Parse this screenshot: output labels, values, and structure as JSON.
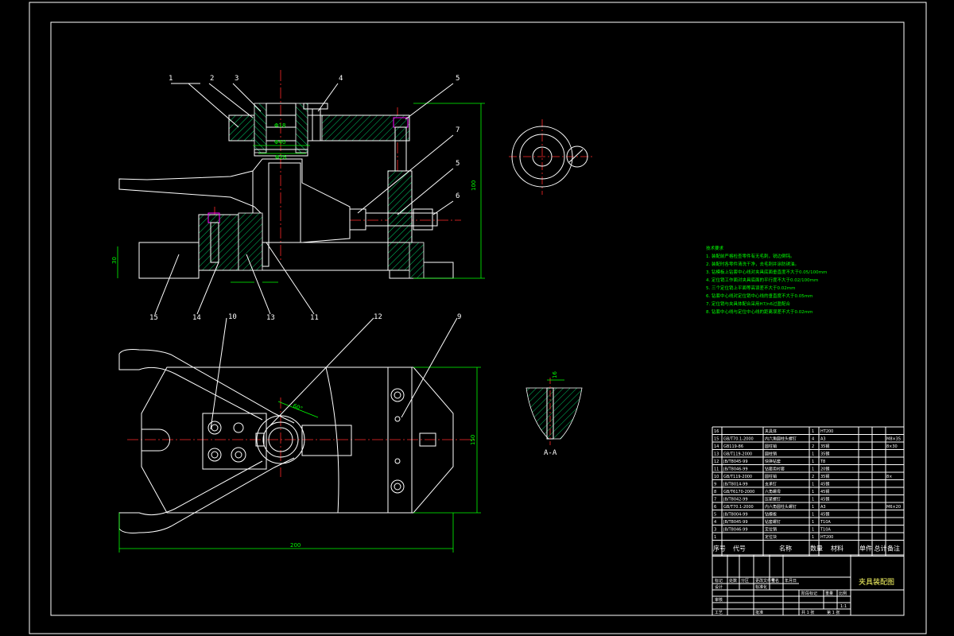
{
  "balloons_front": [
    "1",
    "2",
    "3",
    "4",
    "5",
    "7",
    "5",
    "6",
    "15",
    "14",
    "13",
    "11"
  ],
  "balloons_top": [
    "10",
    "12",
    "9"
  ],
  "section_label": "A-A",
  "tech_title": "技术要求",
  "tech_notes": [
    "1. 装配前严格检查零件有无毛刺，锐边倒钝。",
    "2. 装配时各零件清洗干净，去毛刺并涂防锈油。",
    "3. 钻模板上钻套中心线对夹具底面垂直度不大于0.05/100mm",
    "4. 定位销工作面对夹具底面的平行度不大于0.02/100mm",
    "5. 三个定位销上平面等高误差不大于0.02mm",
    "6. 钻套中心线对定位销中心线的垂直度不大于0.05mm",
    "7. 定位销与夹具体配合采用H7/n6过盈配合",
    "8. 钻套中心线与定位中心线的距离误差不大于0.02mm"
  ],
  "bom_rows": [
    {
      "no": "16",
      "code": "",
      "name": "夹具体",
      "qty": "1",
      "mat": "HT200",
      "note": ""
    },
    {
      "no": "15",
      "code": "GB/T70.1-2000",
      "name": "内六角圆柱头螺钉",
      "qty": "4",
      "mat": "A3",
      "note": "M8×35"
    },
    {
      "no": "14",
      "code": "GB119-86",
      "name": "圆柱销",
      "qty": "2",
      "mat": "35钢",
      "note": "8×30"
    },
    {
      "no": "13",
      "code": "GB/T119-2000",
      "name": "圆柱销",
      "qty": "1",
      "mat": "35钢",
      "note": ""
    },
    {
      "no": "12",
      "code": "JB/T8045-99",
      "name": "快换钻套",
      "qty": "1",
      "mat": "T8",
      "note": ""
    },
    {
      "no": "11",
      "code": "JB/T8046-99",
      "name": "钻套用衬套",
      "qty": "1",
      "mat": "20钢",
      "note": ""
    },
    {
      "no": "10",
      "code": "GB/T119-2000",
      "name": "圆柱销",
      "qty": "2",
      "mat": "35钢",
      "note": "8×"
    },
    {
      "no": "9",
      "code": "JB/T8014-99",
      "name": "支承钉",
      "qty": "1",
      "mat": "45钢",
      "note": ""
    },
    {
      "no": "8",
      "code": "GB/T6170-2000",
      "name": "六角螺母",
      "qty": "1",
      "mat": "45钢",
      "note": ""
    },
    {
      "no": "7",
      "code": "JB/T8042-99",
      "name": "压紧螺钉",
      "qty": "1",
      "mat": "45钢",
      "note": ""
    },
    {
      "no": "6",
      "code": "GB/T70.1-2000",
      "name": "内六角圆柱头螺钉",
      "qty": "1",
      "mat": "A3",
      "note": "M6×20"
    },
    {
      "no": "5",
      "code": "JB/T8004-99",
      "name": "钻模板",
      "qty": "1",
      "mat": "45钢",
      "note": ""
    },
    {
      "no": "4",
      "code": "JB/T8045-99",
      "name": "钻套螺钉",
      "qty": "1",
      "mat": "T10A",
      "note": ""
    },
    {
      "no": "3",
      "code": "JB/T8046-99",
      "name": "定位销",
      "qty": "1",
      "mat": "T10A",
      "note": ""
    },
    {
      "no": "1",
      "code": "",
      "name": "定位块",
      "qty": "1",
      "mat": "HT200",
      "note": ""
    }
  ],
  "bom_header": {
    "no": "序号",
    "code": "代号",
    "name": "名称",
    "qty": "数量",
    "mat": "材料",
    "unit": "单件 总计",
    "weight": "重量",
    "note": "备注"
  },
  "title_block": {
    "drawing_title": "夹具装配图",
    "labels": [
      "标记",
      "处数",
      "分区",
      "更改文件号",
      "签名",
      "年月日",
      "设计",
      "标准化",
      "审核",
      "工艺",
      "批准",
      "阶段标记",
      "重量",
      "比例",
      "共 1 张",
      "第 1 张"
    ],
    "scale": "1:1"
  },
  "dims": {
    "d1": "Φ40",
    "d2": "Φ26",
    "d3": "Φ18",
    "h1": "100",
    "h2": "30",
    "l1": "200",
    "w1": "150",
    "a1": "60°",
    "a2": "16"
  }
}
